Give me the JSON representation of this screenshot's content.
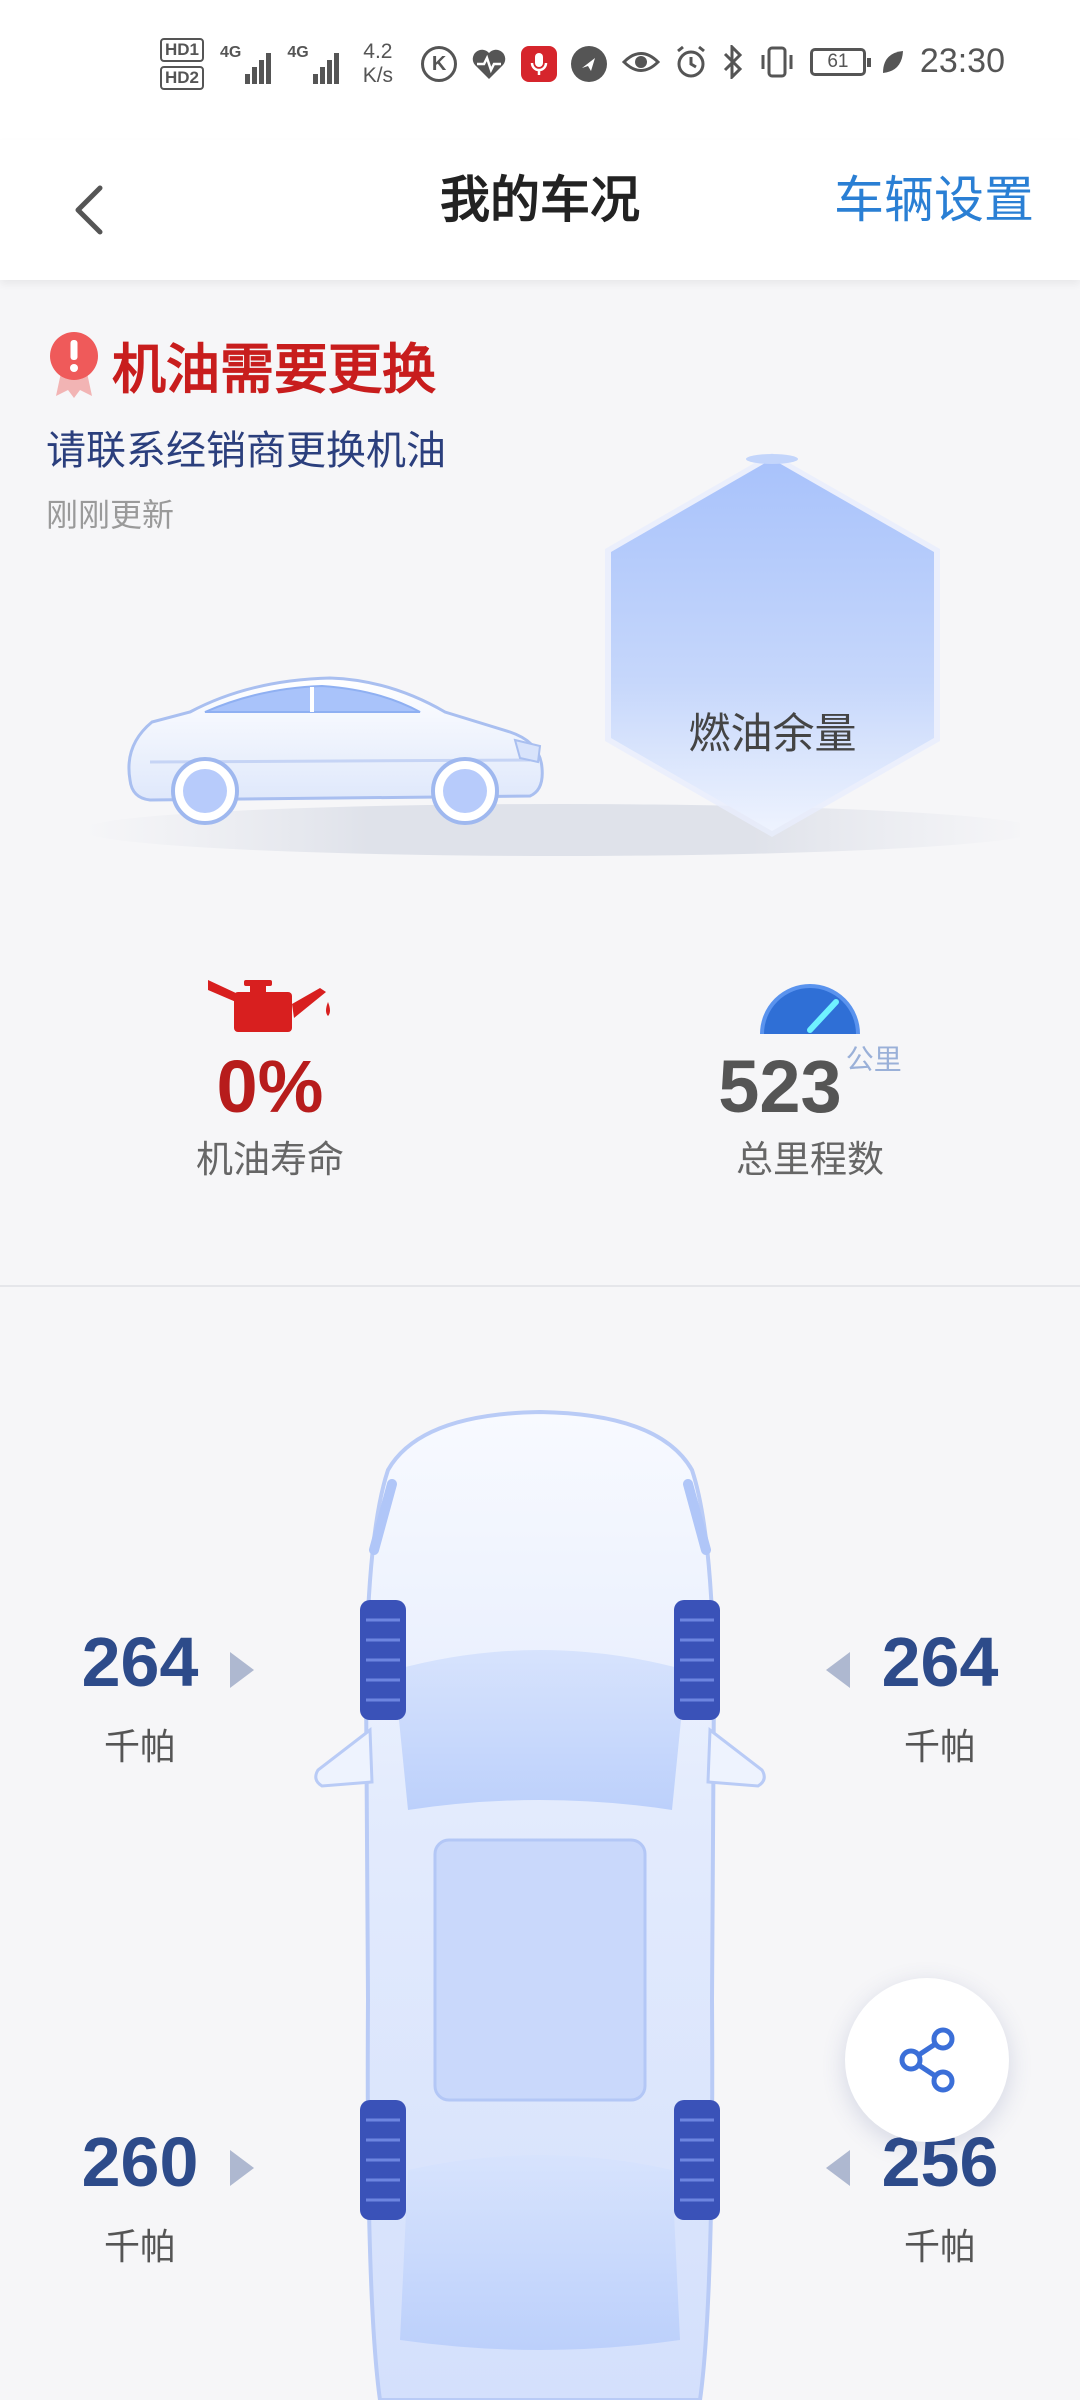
{
  "status_bar": {
    "hd1": "HD1",
    "hd2": "HD2",
    "sig1_label": "4G",
    "sig2_label": "4G",
    "speed_value": "4.2",
    "speed_unit": "K/s",
    "battery": "61",
    "time": "23:30"
  },
  "header": {
    "title": "我的车况",
    "settings_label": "车辆设置"
  },
  "alert": {
    "title": "机油需要更换",
    "subtitle": "请联系经销商更换机油",
    "updated": "刚刚更新"
  },
  "fuel": {
    "label": "燃油余量"
  },
  "stats": {
    "oil_life_value": "0%",
    "oil_life_label": "机油寿命",
    "odometer_value": "523",
    "odometer_unit": "公里",
    "odometer_label": "总里程数"
  },
  "tires": {
    "front_left": "264",
    "front_right": "264",
    "rear_left": "260",
    "rear_right": "256",
    "unit": "千帕"
  },
  "colors": {
    "accent": "#2a7fd4",
    "alert": "#c81d1d",
    "tire_value": "#2d4b8a"
  }
}
